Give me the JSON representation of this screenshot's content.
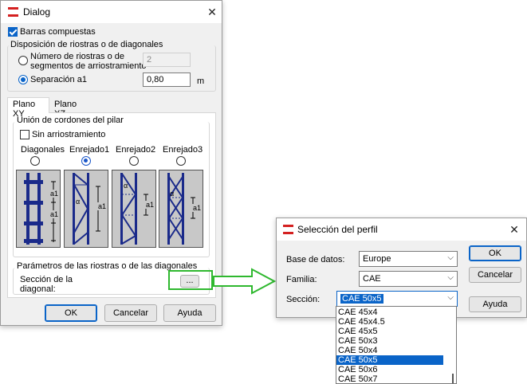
{
  "dialog": {
    "title": "Dialog",
    "barras_compuestas_label": "Barras compuestas",
    "disposicion_title": "Disposición de riostras o de diagonales",
    "numero_label_line1": "Número de riostras o de",
    "numero_label_line2": "segmentos de arriostramiento",
    "numero_value": "2",
    "separacion_label": "Separación a1",
    "separacion_value": "0,80",
    "unit": "m",
    "tabs": [
      {
        "label": "Plano XY"
      },
      {
        "label": "Plano XZ"
      }
    ],
    "union_title": "Unión de cordones del pilar",
    "sin_arriostramiento_label": "Sin arriostramiento",
    "options": [
      {
        "label": "Diagonales"
      },
      {
        "label": "Enrejado1"
      },
      {
        "label": "Enrejado2"
      },
      {
        "label": "Enrejado3"
      }
    ],
    "diagram_labels": {
      "a1": "a1",
      "alpha": "α"
    },
    "parametros_title": "Parámetros de las riostras o de las diagonales",
    "seccion_label_line1": "Sección de la",
    "seccion_label_line2": "diagonal:",
    "browse_label": "...",
    "ok_label": "OK",
    "cancel_label": "Cancelar",
    "help_label": "Ayuda"
  },
  "profile_dialog": {
    "title": "Selección del perfil",
    "base_label": "Base de datos:",
    "base_value": "Europe",
    "familia_label": "Familia:",
    "familia_value": "CAE",
    "seccion_label": "Sección:",
    "seccion_value": "CAE 50x5",
    "list_items": [
      "CAE 45x4",
      "CAE 45x4.5",
      "CAE 45x5",
      "CAE 50x3",
      "CAE 50x4",
      "CAE 50x5",
      "CAE 50x6",
      "CAE 50x7"
    ],
    "selected_index": 5,
    "ok_label": "OK",
    "cancel_label": "Cancelar",
    "help_label": "Ayuda"
  },
  "colors": {
    "accent": "#0a64c8",
    "highlight_green": "#2fb82f",
    "diagram_blue": "#1a2a8a",
    "diagram_bg": "#c8c8c8",
    "app_icon_red": "#d42020"
  },
  "icons": {
    "app": "app-logo-icon",
    "close": "close-icon",
    "dropdown": "chevron-down-icon"
  }
}
